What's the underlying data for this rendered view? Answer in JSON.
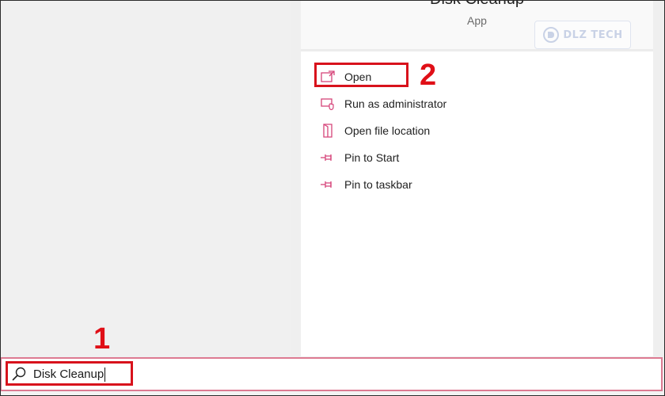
{
  "app": {
    "title": "Disk Cleanup",
    "type": "App"
  },
  "watermark": {
    "text": "DLZ TECH"
  },
  "actions": [
    {
      "label": "Open",
      "icon": "open-icon"
    },
    {
      "label": "Run as administrator",
      "icon": "shield-run-icon"
    },
    {
      "label": "Open file location",
      "icon": "folder-location-icon"
    },
    {
      "label": "Pin to Start",
      "icon": "pin-icon"
    },
    {
      "label": "Pin to taskbar",
      "icon": "pin-icon"
    }
  ],
  "search": {
    "value": "Disk Cleanup",
    "icon": "search-icon"
  },
  "steps": {
    "step1": "1",
    "step2": "2"
  },
  "colors": {
    "accent_icon": "#d6457a",
    "highlight": "#d8121c",
    "search_border": "#dd7a92"
  }
}
